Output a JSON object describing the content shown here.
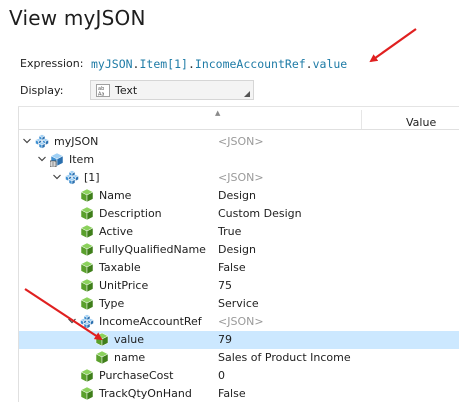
{
  "window": {
    "title": "View myJSON"
  },
  "expression": {
    "label": "Expression:",
    "parts": [
      "myJSON",
      ".",
      "Item[1]",
      ".",
      "IncomeAccountRef",
      ".",
      "value"
    ]
  },
  "display": {
    "label": "Display:",
    "value": "Text",
    "icon": "text-format-icon"
  },
  "tree": {
    "columns": {
      "sort_indicator": "▲",
      "value_header": "Value"
    },
    "rows": [
      {
        "name": "myJSON",
        "value": "<JSON>",
        "icon": "object-cube-icon",
        "expander": "expanded"
      },
      {
        "name": "Item",
        "value": "",
        "icon": "array-cube-icon",
        "expander": "expanded"
      },
      {
        "name": "[1]",
        "value": "<JSON>",
        "icon": "object-cube-icon",
        "expander": "expanded"
      },
      {
        "name": "Name",
        "value": "Design",
        "icon": "value-cube-icon"
      },
      {
        "name": "Description",
        "value": "Custom Design",
        "icon": "value-cube-icon"
      },
      {
        "name": "Active",
        "value": "True",
        "icon": "value-cube-icon"
      },
      {
        "name": "FullyQualifiedName",
        "value": "Design",
        "icon": "value-cube-icon"
      },
      {
        "name": "Taxable",
        "value": "False",
        "icon": "value-cube-icon"
      },
      {
        "name": "UnitPrice",
        "value": "75",
        "icon": "value-cube-icon"
      },
      {
        "name": "Type",
        "value": "Service",
        "icon": "value-cube-icon"
      },
      {
        "name": "IncomeAccountRef",
        "value": "<JSON>",
        "icon": "object-cube-icon",
        "expander": "expanded"
      },
      {
        "name": "value",
        "value": "79",
        "icon": "value-cube-icon",
        "selected": true
      },
      {
        "name": "name",
        "value": "Sales of Product Income",
        "icon": "value-cube-icon"
      },
      {
        "name": "PurchaseCost",
        "value": "0",
        "icon": "value-cube-icon"
      },
      {
        "name": "TrackQtyOnHand",
        "value": "False",
        "icon": "value-cube-icon"
      }
    ]
  },
  "colors": {
    "selection": "#cce8ff",
    "expression_text": "#1e7ba6",
    "arrow": "#e02020",
    "cube_green": "#5aa02c",
    "cube_blue": "#3d8fd1"
  }
}
